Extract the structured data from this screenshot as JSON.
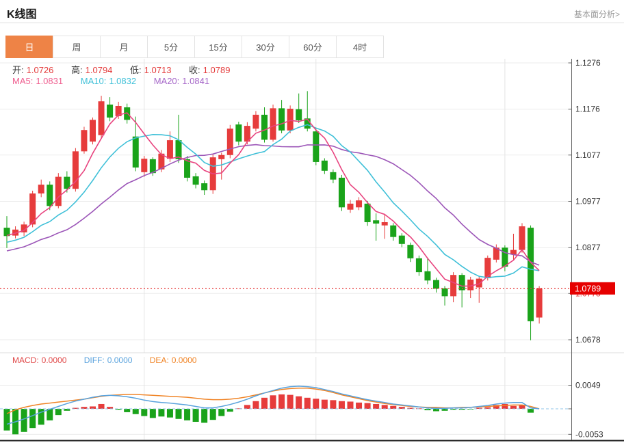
{
  "header": {
    "title": "K线图",
    "link": "基本面分析>"
  },
  "tabs": {
    "items": [
      "日",
      "周",
      "月",
      "5分",
      "15分",
      "30分",
      "60分",
      "4时"
    ],
    "active_index": 0
  },
  "ohlc": {
    "open_label": "开:",
    "open": "1.0726",
    "high_label": "高:",
    "high": "1.0794",
    "low_label": "低:",
    "low": "1.0713",
    "close_label": "收:",
    "close": "1.0789"
  },
  "ma": {
    "ma5_label": "MA5:",
    "ma5": "1.0831",
    "ma10_label": "MA10:",
    "ma10": "1.0832",
    "ma20_label": "MA20:",
    "ma20": "1.0841"
  },
  "macd_labels": {
    "macd_label": "MACD:",
    "macd_value": "0.0000",
    "diff_label": "DIFF:",
    "diff_value": "0.0000",
    "dea_label": "DEA:",
    "dea_value": "0.0000"
  },
  "colors": {
    "accent_orange": "#ee8346",
    "up_red": "#e63c3c",
    "down_green": "#1aa31a",
    "badge_red": "#e60000",
    "price_line_red": "#e84040",
    "ma5_pink": "#e8447f",
    "ma10_cyan": "#3fc0d8",
    "ma20_purple": "#9c56b8",
    "diff_blue": "#58a2dd",
    "dea_orange": "#f08426",
    "zero_dash_blue": "#8fc4ea",
    "grid_gray": "#ebebeb",
    "axis_gray": "#666666",
    "tick_text": "#333333",
    "ma5_text": "#ef5e8f",
    "ma10_text": "#3fc0d8",
    "ma20_text": "#a566c8",
    "macd_text_red": "#e04848",
    "value_red": "#e43c3c"
  },
  "chart_data": {
    "type": "candlestick+macd",
    "title": "K线图 日线 (daily K-line with MA5/MA10/MA20 and MACD)",
    "price_axis_ticks": [
      1.1276,
      1.1176,
      1.1077,
      1.0977,
      1.0877,
      1.0778,
      1.0678
    ],
    "macd_axis_ticks": [
      0.0049,
      -0.0053
    ],
    "current_price": 1.0789,
    "legend": [
      "MA5",
      "MA10",
      "MA20",
      "MACD",
      "DIFF",
      "DEA"
    ],
    "candles_ohlc": [
      [
        1.092,
        1.0945,
        1.0876,
        1.0902
      ],
      [
        1.0903,
        1.0923,
        1.0897,
        1.0916
      ],
      [
        1.091,
        1.0933,
        1.0902,
        1.0927
      ],
      [
        1.0927,
        1.1,
        1.0921,
        1.0994
      ],
      [
        1.0994,
        1.1024,
        1.0986,
        1.1013
      ],
      [
        1.1013,
        1.102,
        1.0958,
        1.0967
      ],
      [
        1.0967,
        1.1038,
        1.0962,
        1.103
      ],
      [
        1.103,
        1.1042,
        1.0996,
        1.1004
      ],
      [
        1.1004,
        1.1092,
        1.0998,
        1.1085
      ],
      [
        1.1085,
        1.1138,
        1.108,
        1.1131
      ],
      [
        1.1106,
        1.1158,
        1.11,
        1.1153
      ],
      [
        1.112,
        1.1205,
        1.1112,
        1.1193
      ],
      [
        1.1186,
        1.1202,
        1.115,
        1.1158
      ],
      [
        1.1161,
        1.1192,
        1.1155,
        1.1183
      ],
      [
        1.118,
        1.1188,
        1.1145,
        1.1153
      ],
      [
        1.1117,
        1.116,
        1.1042,
        1.105
      ],
      [
        1.104,
        1.1075,
        1.103,
        1.1069
      ],
      [
        1.1068,
        1.1072,
        1.1032,
        1.1038
      ],
      [
        1.1046,
        1.1088,
        1.104,
        1.108
      ],
      [
        1.1069,
        1.1128,
        1.1062,
        1.1109
      ],
      [
        1.1109,
        1.1164,
        1.106,
        1.1068
      ],
      [
        1.1068,
        1.1075,
        1.102,
        1.1028
      ],
      [
        1.1031,
        1.1038,
        1.1005,
        1.1013
      ],
      [
        1.1016,
        1.1022,
        1.0991,
        1.1001
      ],
      [
        1.1001,
        1.1078,
        1.0993,
        1.1072
      ],
      [
        1.1068,
        1.1082,
        1.1024,
        1.1077
      ],
      [
        1.1077,
        1.1142,
        1.107,
        1.1134
      ],
      [
        1.1143,
        1.1149,
        1.1098,
        1.1106
      ],
      [
        1.1106,
        1.1148,
        1.11,
        1.114
      ],
      [
        1.1134,
        1.1172,
        1.1128,
        1.1164
      ],
      [
        1.1164,
        1.118,
        1.1104,
        1.111
      ],
      [
        1.111,
        1.1186,
        1.1106,
        1.1178
      ],
      [
        1.1178,
        1.1196,
        1.1124,
        1.113
      ],
      [
        1.113,
        1.1184,
        1.1124,
        1.1177
      ],
      [
        1.1176,
        1.121,
        1.1146,
        1.1152
      ],
      [
        1.1156,
        1.1215,
        1.1128,
        1.1134
      ],
      [
        1.1128,
        1.1134,
        1.1055,
        1.1062
      ],
      [
        1.1065,
        1.107,
        1.1036,
        1.1043
      ],
      [
        1.104,
        1.1046,
        1.1016,
        1.1024
      ],
      [
        1.1028,
        1.1034,
        1.0956,
        1.0964
      ],
      [
        1.0959,
        1.098,
        1.0952,
        1.0972
      ],
      [
        1.0964,
        1.0986,
        1.0958,
        1.0979
      ],
      [
        1.0972,
        1.0978,
        1.0924,
        1.0932
      ],
      [
        1.0936,
        1.0951,
        1.0892,
        1.0929
      ],
      [
        1.0925,
        1.095,
        1.0896,
        1.0932
      ],
      [
        1.0925,
        1.093,
        1.0892,
        1.09
      ],
      [
        1.0903,
        1.0908,
        1.0878,
        1.0885
      ],
      [
        1.0883,
        1.0888,
        1.0846,
        1.0854
      ],
      [
        1.0854,
        1.086,
        1.0816,
        1.0824
      ],
      [
        1.0826,
        1.0855,
        1.0798,
        1.0806
      ],
      [
        1.0807,
        1.0812,
        1.078,
        1.0788
      ],
      [
        1.0789,
        1.0794,
        1.0752,
        1.0772
      ],
      [
        1.0772,
        1.0824,
        1.0759,
        1.0818
      ],
      [
        1.0818,
        1.0822,
        1.0748,
        1.0785
      ],
      [
        1.0785,
        1.0814,
        1.0768,
        1.0808
      ],
      [
        1.0791,
        1.0815,
        1.0758,
        1.081
      ],
      [
        1.0811,
        1.086,
        1.0806,
        1.0855
      ],
      [
        1.0851,
        1.0884,
        1.0845,
        1.0877
      ],
      [
        1.0877,
        1.0882,
        1.0826,
        1.0836
      ],
      [
        1.0862,
        1.0907,
        1.085,
        1.0872
      ],
      [
        1.0872,
        1.093,
        1.0866,
        1.0923
      ],
      [
        1.092,
        1.0925,
        1.0677,
        1.0718
      ],
      [
        1.0726,
        1.0794,
        1.0713,
        1.0789
      ]
    ],
    "ma_prehistory": [
      1.083,
      1.0836,
      1.0842,
      1.0848,
      1.0854,
      1.086,
      1.0866,
      1.086,
      1.0855,
      1.0862,
      1.087,
      1.0866,
      1.0872,
      1.0878,
      1.0884,
      1.089,
      1.0898,
      1.0908,
      1.0918
    ],
    "macd_hist": [
      -0.0045,
      -0.0053,
      -0.0048,
      -0.004,
      -0.0033,
      -0.0024,
      -0.0013,
      -0.0004,
      0.0002,
      0.0004,
      0.0005,
      0.001,
      0.0004,
      -0.0002,
      -0.0007,
      -0.0011,
      -0.0015,
      -0.0019,
      -0.0016,
      -0.0018,
      -0.0021,
      -0.0024,
      -0.0027,
      -0.0029,
      -0.0023,
      -0.0015,
      -0.0006,
      0.0001,
      0.0008,
      0.0016,
      0.0023,
      0.0028,
      0.003,
      0.0029,
      0.0026,
      0.0023,
      0.0021,
      0.0019,
      0.0018,
      0.0016,
      0.0015,
      0.0013,
      0.0012,
      0.001,
      0.0008,
      0.0006,
      0.0004,
      0.0002,
      0.0001,
      -0.0003,
      -0.0005,
      -0.0004,
      -0.0002,
      -0.0002,
      -0.0001,
      0.0002,
      0.0003,
      0.0008,
      0.001,
      0.0006,
      0.0008,
      -0.0008,
      0.0
    ],
    "diff_line": [
      -0.0032,
      -0.0027,
      -0.0021,
      -0.0014,
      -0.0007,
      -0.0001,
      0.0005,
      0.0011,
      0.0016,
      0.002,
      0.0024,
      0.0027,
      0.0028,
      0.0027,
      0.0025,
      0.0022,
      0.0018,
      0.0015,
      0.0013,
      0.0012,
      0.001,
      0.0008,
      0.0005,
      0.0002,
      0.0002,
      0.0005,
      0.0009,
      0.0014,
      0.002,
      0.0027,
      0.0033,
      0.0038,
      0.0043,
      0.0046,
      0.0047,
      0.0046,
      0.0044,
      0.004,
      0.0036,
      0.0031,
      0.0027,
      0.0023,
      0.0019,
      0.0016,
      0.0013,
      0.001,
      0.0008,
      0.0006,
      0.0004,
      0.0002,
      0.0001,
      0.0001,
      0.0002,
      0.0002,
      0.0003,
      0.0005,
      0.0007,
      0.001,
      0.0012,
      0.0013,
      0.0013,
      0.0002,
      0.0
    ],
    "dea_line": [
      -0.001,
      -0.0002,
      0.0003,
      0.0007,
      0.001,
      0.0012,
      0.0014,
      0.0016,
      0.0018,
      0.002,
      0.0023,
      0.0026,
      0.0028,
      0.0029,
      0.003,
      0.003,
      0.0029,
      0.0028,
      0.0027,
      0.0026,
      0.0025,
      0.0024,
      0.0022,
      0.002,
      0.0019,
      0.0019,
      0.002,
      0.0022,
      0.0025,
      0.0029,
      0.0033,
      0.0037,
      0.004,
      0.0042,
      0.0043,
      0.0043,
      0.0041,
      0.0038,
      0.0034,
      0.0029,
      0.0025,
      0.0021,
      0.0017,
      0.0014,
      0.0011,
      0.0009,
      0.0007,
      0.0005,
      0.0004,
      0.0003,
      0.0003,
      0.0002,
      0.0002,
      0.0003,
      0.0003,
      0.0004,
      0.0005,
      0.0006,
      0.0007,
      0.0008,
      0.0008,
      0.0005,
      0.0
    ]
  }
}
